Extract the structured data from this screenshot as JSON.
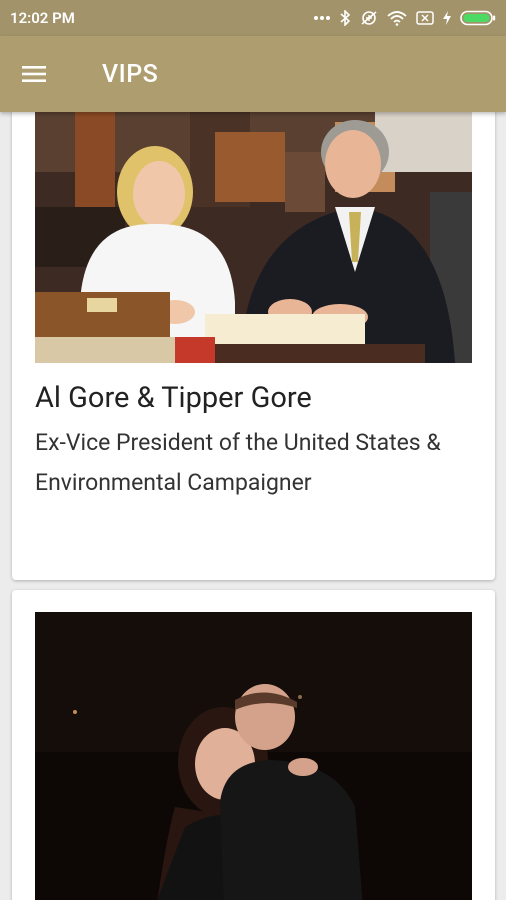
{
  "status_bar": {
    "time": "12:02 PM",
    "icons": [
      "more-dots-icon",
      "bluetooth-icon",
      "data-saver-icon",
      "wifi-icon",
      "no-sim-icon",
      "charging-icon",
      "battery-icon"
    ]
  },
  "app_bar": {
    "menu_icon": "hamburger-menu-icon",
    "title": "VIPS"
  },
  "vips": [
    {
      "name": "Al Gore & Tipper Gore",
      "description": "Ex-Vice President of the United States & Environmental Campaigner",
      "photo_icon": "photo-al-gore-tipper-gore"
    },
    {
      "name": "",
      "description": "",
      "photo_icon": "photo-couple-portrait"
    }
  ],
  "colors": {
    "status_bar": "#a2936a",
    "app_bar": "#ad9d6f",
    "background": "#ececec",
    "battery": "#4cd964"
  }
}
